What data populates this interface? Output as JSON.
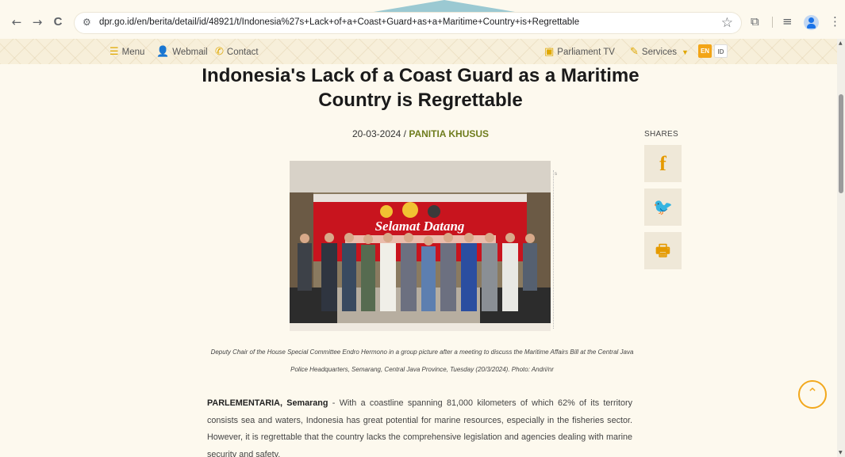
{
  "browser": {
    "url": "dpr.go.id/en/berita/detail/id/48921/t/Indonesia%27s+Lack+of+a+Coast+Guard+as+a+Maritime+Country+is+Regrettable",
    "back_icon": "←",
    "forward_icon": "→",
    "reload_icon": "C",
    "site_info_icon": "⚙",
    "bookmark_icon": "☆",
    "extensions_icon": "⧉",
    "reading_list_icon": "≡",
    "menu_icon": "⋮"
  },
  "sitebar": {
    "menu_label": "Menu",
    "webmail_label": "Webmail",
    "contact_label": "Contact",
    "parliament_tv_label": "Parliament TV",
    "services_label": "Services",
    "lang_en": "EN",
    "lang_id": "ID"
  },
  "article": {
    "title": "Indonesia's Lack of a Coast Guard as a Maritime Country is Regrettable",
    "date": "20-03-2024",
    "separator": " / ",
    "category": "PANITIA KHUSUS",
    "photo_banner_text": "Selamat Datang",
    "photo_side_mark": "s",
    "caption": "Deputy Chair of the House Special Committee Endro Hermono in a group picture after a meeting to discuss the Maritime Affairs Bill at the Central Java Police Headquarters, Semarang, Central Java Province, Tuesday (20/3/2024). Photo: Andri/nr",
    "lead": "PARLEMENTARIA, Semarang",
    "body": " - With a coastline spanning 81,000 kilometers of which 62% of its territory consists sea and waters, Indonesia has great potential for marine resources, especially in the fisheries sector. However, it is regrettable that the country lacks the comprehensive legislation and agencies dealing with marine security and safety."
  },
  "shares": {
    "label": "SHARES",
    "facebook": "f",
    "twitter": "🐦",
    "print": "🖶"
  },
  "scroll_top_icon": "⌃",
  "colors": {
    "accent": "#f2a81d",
    "category": "#6f7d1d",
    "page_bg": "#fdf9ee"
  }
}
